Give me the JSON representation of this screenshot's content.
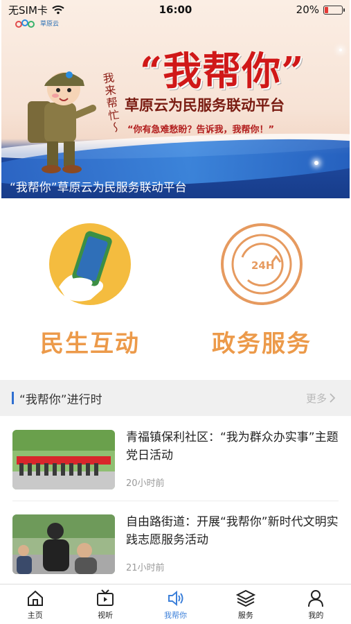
{
  "status_bar": {
    "carrier": "无SIM卡",
    "time": "16:00",
    "battery_percent": "20%",
    "battery_level": 0.2
  },
  "banner": {
    "logo_text": "草原云",
    "headline": "“我帮你”",
    "subtitle": "草原云为民服务联动平台",
    "quote": "“你有急难愁盼？告诉我，我帮你！”",
    "handwriting": "我来帮忙～",
    "caption": "“我帮你”草原云为民服务联动平台"
  },
  "services": [
    {
      "label": "民生互动",
      "icon": "phone-hand-icon"
    },
    {
      "label": "政务服务",
      "icon": "24h-clock-icon",
      "icon_text": "24H"
    }
  ],
  "section": {
    "title": "“我帮你”进行时",
    "more_label": "更多"
  },
  "news": [
    {
      "title": "青福镇保利社区：“我为群众办实事”主题党日活动",
      "time": "20小时前"
    },
    {
      "title": "自由路街道：开展“我帮你”新时代文明实践志愿服务活动",
      "time": "21小时前"
    }
  ],
  "tabs": [
    {
      "label": "主页",
      "icon": "home-icon",
      "active": false
    },
    {
      "label": "视听",
      "icon": "tv-icon",
      "active": false
    },
    {
      "label": "我帮你",
      "icon": "speaker-icon",
      "active": true
    },
    {
      "label": "服务",
      "icon": "layers-icon",
      "active": false
    },
    {
      "label": "我的",
      "icon": "person-icon",
      "active": false
    }
  ],
  "colors": {
    "accent_blue": "#3b7fd9",
    "service_orange": "#ec9a4a",
    "headline_red": "#d01818"
  }
}
